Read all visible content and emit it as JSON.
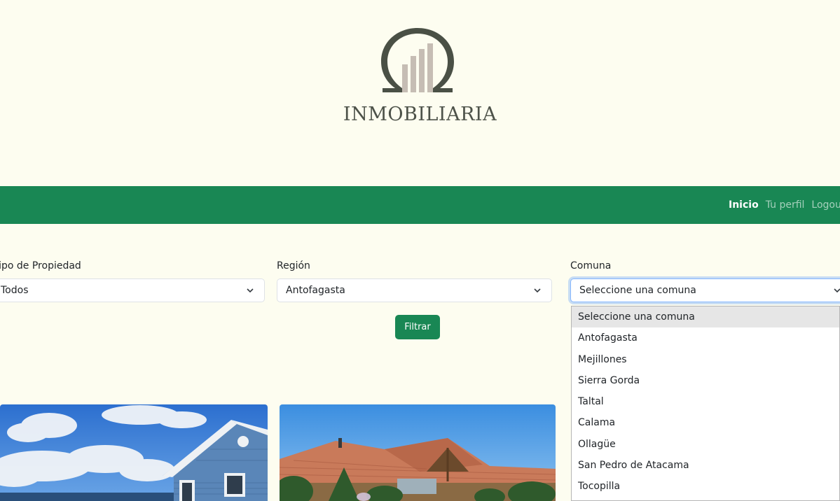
{
  "brand": {
    "name": "INMOBILIARIA",
    "logo_icon": "building-arch-icon",
    "colors": {
      "ring": "#4a5045",
      "bars": "#c6bdb4"
    }
  },
  "navbar": {
    "background": "#198754",
    "links": [
      {
        "label": "Inicio",
        "active": true
      },
      {
        "label": "Tu perfil",
        "active": false
      },
      {
        "label": "Logout",
        "active": false
      }
    ]
  },
  "filters": {
    "tipo": {
      "label": "Tipo de Propiedad",
      "value": "Todos"
    },
    "region": {
      "label": "Región",
      "value": "Antofagasta"
    },
    "comuna": {
      "label": "Comuna",
      "value": "Seleccione una comuna",
      "options": [
        "Seleccione una comuna",
        "Antofagasta",
        "Mejillones",
        "Sierra Gorda",
        "Taltal",
        "Calama",
        "Ollagüe",
        "San Pedro de Atacama",
        "Tocopilla"
      ]
    },
    "submit_label": "Filtrar"
  },
  "cards": [
    {
      "image": "blue-house-photo"
    },
    {
      "image": "tile-roof-house-photo"
    }
  ]
}
